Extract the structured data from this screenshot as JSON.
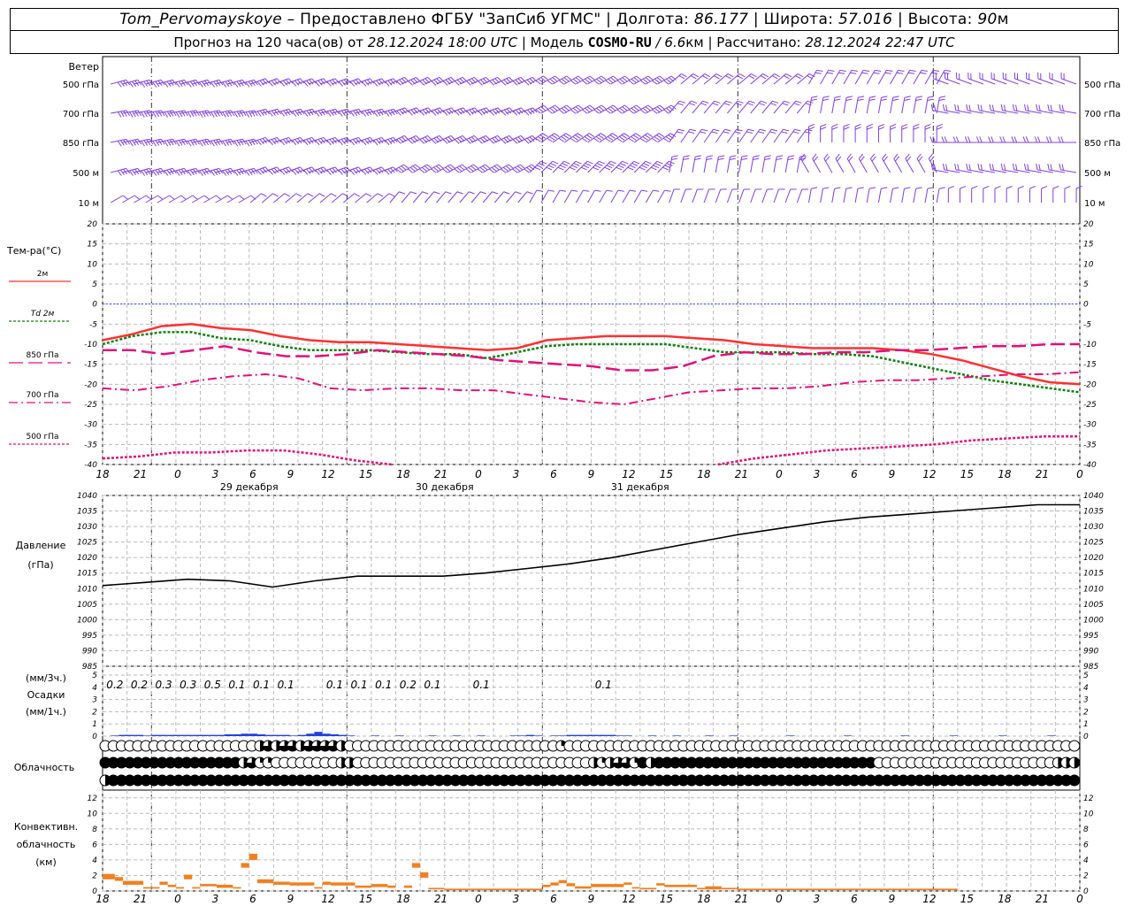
{
  "header": {
    "station": "Tom_Pervomayskoye",
    "provided_by": " – Предоставлено ФГБУ \"ЗапСиб УГМС\" | Долгота: ",
    "lon": "86.177",
    "lat_label": " | Широта: ",
    "lat": "57.016",
    "alt_label": " | Высота: ",
    "alt": "90",
    "alt_unit": "м",
    "forecast_prefix": "Прогноз на 120 часа(ов) от ",
    "forecast_time": "28.12.2024 18:00 UTC",
    "model_label": " | Модель ",
    "model": "COSMO-RU",
    "model_res": " / 6.6",
    "model_res_unit": "км",
    "calc_label": " | Рассчитано: ",
    "calc_time": "28.12.2024 22:47 UTC"
  },
  "time_axis": {
    "tick_labels": [
      "18",
      "21",
      "0",
      "3",
      "6",
      "9",
      "12",
      "15",
      "18",
      "21",
      "0",
      "3",
      "6",
      "9",
      "12",
      "15",
      "18",
      "21",
      "0",
      "3",
      "6",
      "9",
      "12",
      "15",
      "18",
      "21",
      "0"
    ],
    "day_labels": [
      "29 декабря",
      "30 декабря",
      "31 декабря"
    ]
  },
  "wind_panel": {
    "title": "Ветер",
    "levels": [
      "500 гПа",
      "700 гПа",
      "850 гПа",
      "500 м",
      "10 м"
    ],
    "barb_color": "#8040e0"
  },
  "colors": {
    "t2m": "#ff3030",
    "td2m": "#108010",
    "t850": "#e0107a",
    "t700": "#e0107a",
    "t500": "#e0107a",
    "zero_line": "#3050ff",
    "pressure": "#000000",
    "precip": "#2040e0",
    "convective": "#f08020",
    "grid": "#bbbbbb"
  },
  "chart_data": [
    {
      "type": "line",
      "title": "Тем-ра(°C)",
      "ylim": [
        -40,
        20
      ],
      "yticks": [
        20,
        15,
        10,
        5,
        0,
        -5,
        -10,
        -15,
        -20,
        -25,
        -30,
        -35,
        -40
      ],
      "x_hours": [
        0,
        3,
        6,
        9,
        12,
        15,
        18,
        21,
        24,
        27,
        30,
        33,
        36,
        39,
        42,
        45,
        48,
        51,
        54,
        57,
        60,
        63,
        66,
        69,
        72,
        75,
        78,
        81,
        84,
        87,
        90,
        93,
        96,
        99,
        102,
        105,
        108,
        111,
        114,
        117,
        120
      ],
      "series": [
        {
          "name": "2м",
          "values": [
            -9,
            -7.5,
            -5.5,
            -5,
            -6,
            -6.5,
            -8,
            -9,
            -9.5,
            -9.5,
            -10,
            -10.5,
            -11,
            -11.5,
            -11,
            -9,
            -8.5,
            -8,
            -8,
            -8,
            -8.5,
            -9,
            -10,
            -10.5,
            -11,
            -11,
            -11,
            -11.5,
            -12.5,
            -14,
            -16,
            -18,
            -19.5,
            -20
          ]
        },
        {
          "name": "Td 2м",
          "values": [
            -10,
            -8,
            -7,
            -7,
            -8.5,
            -9,
            -10.5,
            -11.5,
            -11.5,
            -11.5,
            -12,
            -12.5,
            -12.5,
            -13.5,
            -12,
            -10.5,
            -10,
            -10,
            -10,
            -10,
            -11,
            -12,
            -12,
            -12,
            -12.5,
            -12.5,
            -13,
            -14.5,
            -16,
            -17.5,
            -19,
            -20,
            -21,
            -22
          ]
        },
        {
          "name": "850 гПа",
          "values": [
            -11.5,
            -11.5,
            -12.5,
            -11.5,
            -10.5,
            -12,
            -13,
            -13,
            -12.5,
            -11.5,
            -12,
            -12.5,
            -13,
            -14,
            -14.5,
            -15,
            -15.5,
            -16.5,
            -16.5,
            -15.5,
            -13,
            -12,
            -12.5,
            -12.5,
            -12,
            -12,
            -11.5,
            -11.5,
            -11,
            -10.5,
            -10.5,
            -10,
            -10
          ]
        },
        {
          "name": "700 гПа",
          "values": [
            -21,
            -21.5,
            -20.5,
            -19,
            -18,
            -17.5,
            -18.5,
            -21,
            -21.5,
            -21,
            -21,
            -21.5,
            -21.5,
            -22.5,
            -23.5,
            -24.5,
            -25,
            -23.5,
            -22,
            -21.5,
            -21,
            -21,
            -20.5,
            -19.5,
            -19,
            -19,
            -18.5,
            -18,
            -17.5,
            -17.5,
            -17
          ]
        },
        {
          "name": "500 гПа",
          "values": [
            -38.5,
            -38,
            -37,
            -37,
            -36.5,
            -36.5,
            -37.5,
            -39,
            -40,
            -41,
            -40.5,
            -39.5,
            -40.5,
            -41.5,
            -41.5,
            -40.5,
            -41,
            -40,
            -38.5,
            -37.5,
            -36.5,
            -36,
            -35.5,
            -35,
            -34,
            -33.5,
            -33,
            -33
          ]
        }
      ]
    },
    {
      "type": "line",
      "title": "Давление (гПа)",
      "ylim": [
        985,
        1040
      ],
      "yticks": [
        1040,
        1035,
        1030,
        1025,
        1020,
        1015,
        1010,
        1005,
        1000,
        995,
        990,
        985
      ],
      "x_hours": [
        0,
        6,
        12,
        18,
        24,
        30,
        36,
        42,
        48,
        54,
        60,
        66,
        72,
        78,
        84,
        90,
        96,
        102,
        108,
        114,
        120
      ],
      "series": [
        {
          "name": "Давление",
          "values": [
            1011,
            1012,
            1013,
            1012.5,
            1010.5,
            1012.5,
            1014,
            1014,
            1014,
            1015,
            1016.5,
            1018,
            1020,
            1022.5,
            1025,
            1027.5,
            1029.5,
            1031.5,
            1033,
            1034,
            1035,
            1036,
            1037,
            1037
          ]
        }
      ]
    },
    {
      "type": "bar",
      "title": "Осадки",
      "subtitle_3h": "(мм/3ч.)",
      "subtitle_1h": "(мм/1ч.)",
      "ylim": [
        0,
        5
      ],
      "yticks": [
        5,
        4,
        3,
        2,
        1,
        0
      ],
      "labels_3h": [
        {
          "hour": 1.5,
          "text": "0.2"
        },
        {
          "hour": 4.5,
          "text": "0.2"
        },
        {
          "hour": 7.5,
          "text": "0.3"
        },
        {
          "hour": 10.5,
          "text": "0.3"
        },
        {
          "hour": 13.5,
          "text": "0.5"
        },
        {
          "hour": 16.5,
          "text": "0.1"
        },
        {
          "hour": 19.5,
          "text": "0.1"
        },
        {
          "hour": 22.5,
          "text": "0.1"
        },
        {
          "hour": 28.5,
          "text": "0.1"
        },
        {
          "hour": 31.5,
          "text": "0.1"
        },
        {
          "hour": 34.5,
          "text": "0.1"
        },
        {
          "hour": 37.5,
          "text": "0.2"
        },
        {
          "hour": 40.5,
          "text": "0.1"
        },
        {
          "hour": 46.5,
          "text": "0.1"
        },
        {
          "hour": 61.5,
          "text": "0.1"
        }
      ],
      "hourly_mm": [
        0,
        0.05,
        0.1,
        0.1,
        0.1,
        0.05,
        0.1,
        0.1,
        0.1,
        0.1,
        0.1,
        0.1,
        0.1,
        0.1,
        0.1,
        0.15,
        0.15,
        0.2,
        0.2,
        0.15,
        0.1,
        0.1,
        0.1,
        0.05,
        0.1,
        0.2,
        0.35,
        0.2,
        0.15,
        0.1,
        0.05,
        0,
        0,
        0.05,
        0,
        0,
        0.05,
        0,
        0,
        0,
        0.05,
        0,
        0,
        0.05,
        0,
        0,
        0.05,
        0,
        0,
        0,
        0.05,
        0.05,
        0.1,
        0.05,
        0,
        0.05,
        0.05,
        0.1,
        0.1,
        0.1,
        0.1,
        0.1,
        0.1,
        0.05,
        0.05,
        0,
        0,
        0.05,
        0,
        0,
        0.05,
        0,
        0,
        0,
        0.05,
        0,
        0,
        0.05,
        0,
        0,
        0,
        0,
        0,
        0,
        0.05,
        0,
        0,
        0,
        0,
        0,
        0,
        0.05,
        0,
        0,
        0,
        0,
        0,
        0,
        0.05,
        0,
        0,
        0,
        0,
        0,
        0.05,
        0,
        0,
        0,
        0,
        0,
        0.05,
        0,
        0,
        0,
        0,
        0,
        0.05,
        0,
        0,
        0,
        0
      ]
    },
    {
      "type": "table",
      "title": "Облачность",
      "rows_fraction": [
        [
          0,
          0,
          0,
          0,
          0,
          0,
          0,
          0,
          0,
          0,
          0,
          0,
          0,
          0,
          0,
          0,
          0,
          0,
          0,
          0.5,
          0.75,
          0.5,
          0.75,
          0.75,
          0.5,
          0.75,
          0.75,
          0.75,
          0.75,
          0.5,
          0,
          0,
          0,
          0,
          0,
          0,
          0,
          0,
          0,
          0,
          0,
          0,
          0,
          0,
          0,
          0,
          0,
          0,
          0,
          0,
          0,
          0,
          0,
          0,
          0,
          0,
          0.25,
          0,
          0,
          0,
          0,
          0,
          0,
          0,
          0,
          0,
          0,
          0,
          0,
          0,
          0,
          0,
          0,
          0,
          0,
          0,
          0,
          0,
          0,
          0,
          0,
          0,
          0,
          0,
          0,
          0,
          0,
          0,
          0,
          0,
          0,
          0,
          0,
          0,
          0,
          0,
          0,
          0,
          0,
          0,
          0,
          0,
          0,
          0,
          0,
          0,
          0,
          0,
          0,
          0,
          0,
          0,
          0,
          0,
          0,
          0,
          0,
          0,
          0,
          0,
          0.5,
          0.5,
          0.25
        ],
        [
          1,
          1,
          1,
          1,
          1,
          1,
          1,
          1,
          1,
          1,
          1,
          1,
          1,
          1,
          1,
          1,
          1,
          0.5,
          0.75,
          0.25,
          0.25,
          0,
          0,
          0,
          0,
          0,
          0,
          0,
          0,
          0.5,
          0.5,
          0,
          0,
          0,
          0,
          0,
          0,
          0,
          0,
          0,
          0,
          0,
          0,
          0,
          0,
          0,
          0,
          0,
          0,
          0,
          0,
          0,
          0,
          0,
          0,
          0,
          0,
          0,
          0,
          0,
          0.5,
          0.25,
          0.5,
          0.75,
          0.75,
          0.25,
          1,
          0.5,
          1,
          1,
          1,
          1,
          1,
          1,
          1,
          1,
          1,
          1,
          1,
          1,
          1,
          1,
          1,
          1,
          1,
          1,
          1,
          1,
          1,
          1,
          1,
          1,
          1,
          1,
          1,
          0,
          0,
          0,
          0,
          0,
          0,
          0,
          0,
          0,
          0,
          0,
          0,
          0,
          0,
          0,
          0,
          0,
          0,
          0,
          0,
          0,
          0,
          0.5,
          0.5,
          0.5,
          0,
          0,
          0,
          0,
          0,
          0,
          0,
          0,
          0,
          0,
          0,
          0,
          0,
          0,
          0,
          0,
          0,
          0.5,
          0.5,
          0.5,
          0.75,
          0.25,
          0.75,
          0.75
        ],
        [
          0.5,
          1,
          1,
          1,
          1,
          1,
          1,
          1,
          1,
          1,
          1,
          1,
          1,
          1,
          1,
          1,
          1,
          1,
          1,
          1,
          1,
          1,
          1,
          1,
          1,
          1,
          1,
          1,
          1,
          1,
          1,
          1,
          1,
          1,
          1,
          1,
          1,
          1,
          1,
          1,
          1,
          1,
          1,
          1,
          1,
          1,
          1,
          1,
          1,
          1,
          1,
          1,
          1,
          1,
          1,
          1,
          1,
          1,
          1,
          1,
          1,
          1,
          1,
          1,
          1,
          1,
          1,
          1,
          1,
          1,
          1,
          1,
          1,
          1,
          1,
          1,
          1,
          1,
          1,
          1,
          1,
          1,
          1,
          1,
          1,
          1,
          1,
          1,
          1,
          1,
          1,
          1,
          1,
          1,
          1,
          1,
          1,
          1,
          1,
          1,
          1,
          1,
          1,
          1,
          1,
          1,
          1,
          1,
          1,
          1,
          1,
          1,
          1,
          1,
          1,
          1,
          1,
          1,
          1,
          1,
          1
        ]
      ]
    },
    {
      "type": "bar",
      "title": "Конвективн. облачность (км)",
      "ylim": [
        0,
        13
      ],
      "yticks": [
        12,
        10,
        8,
        6,
        4,
        2,
        0
      ],
      "segments": [
        {
          "h0": 0,
          "h1": 1.5,
          "base": 1.5,
          "top": 2.2
        },
        {
          "h0": 1.5,
          "h1": 2.5,
          "base": 1.3,
          "top": 1.8
        },
        {
          "h0": 2.5,
          "h1": 5,
          "base": 0.8,
          "top": 1.3
        },
        {
          "h0": 5,
          "h1": 7,
          "base": 0.3,
          "top": 0.5
        },
        {
          "h0": 7,
          "h1": 8,
          "base": 0.8,
          "top": 1.2
        },
        {
          "h0": 8,
          "h1": 9,
          "base": 0.5,
          "top": 0.8
        },
        {
          "h0": 9,
          "h1": 10,
          "base": 0.3,
          "top": 0.5
        },
        {
          "h0": 10,
          "h1": 11,
          "base": 1.5,
          "top": 2.1
        },
        {
          "h0": 11,
          "h1": 12,
          "base": 0.3,
          "top": 0.5
        },
        {
          "h0": 12,
          "h1": 14,
          "base": 0.6,
          "top": 0.9
        },
        {
          "h0": 14,
          "h1": 16,
          "base": 0.4,
          "top": 0.8
        },
        {
          "h0": 16,
          "h1": 17,
          "base": 0.3,
          "top": 0.5
        },
        {
          "h0": 17,
          "h1": 18,
          "base": 3,
          "top": 3.6
        },
        {
          "h0": 18,
          "h1": 19,
          "base": 4,
          "top": 4.8
        },
        {
          "h0": 19,
          "h1": 21,
          "base": 1,
          "top": 1.5
        },
        {
          "h0": 21,
          "h1": 23,
          "base": 0.8,
          "top": 1.2
        },
        {
          "h0": 23,
          "h1": 26,
          "base": 0.7,
          "top": 1.1
        },
        {
          "h0": 26,
          "h1": 27,
          "base": 0.3,
          "top": 0.5
        },
        {
          "h0": 27,
          "h1": 28,
          "base": 0.8,
          "top": 1.2
        },
        {
          "h0": 28,
          "h1": 31,
          "base": 0.7,
          "top": 1.1
        },
        {
          "h0": 31,
          "h1": 33,
          "base": 0.4,
          "top": 0.7
        },
        {
          "h0": 33,
          "h1": 35,
          "base": 0.5,
          "top": 0.9
        },
        {
          "h0": 35,
          "h1": 36,
          "base": 0.4,
          "top": 0.7
        },
        {
          "h0": 37,
          "h1": 38,
          "base": 0.4,
          "top": 0.7
        },
        {
          "h0": 38,
          "h1": 39,
          "base": 3,
          "top": 3.6
        },
        {
          "h0": 39,
          "h1": 40,
          "base": 1.7,
          "top": 2.4
        },
        {
          "h0": 40,
          "h1": 42,
          "base": 0.2,
          "top": 0.4
        },
        {
          "h0": 42,
          "h1": 54,
          "base": 0.1,
          "top": 0.3
        },
        {
          "h0": 54,
          "h1": 55,
          "base": 0.5,
          "top": 0.8
        },
        {
          "h0": 55,
          "h1": 56,
          "base": 0.7,
          "top": 1.1
        },
        {
          "h0": 56,
          "h1": 57,
          "base": 1,
          "top": 1.4
        },
        {
          "h0": 57,
          "h1": 58,
          "base": 0.6,
          "top": 1
        },
        {
          "h0": 58,
          "h1": 60,
          "base": 0.3,
          "top": 0.6
        },
        {
          "h0": 60,
          "h1": 64,
          "base": 0.5,
          "top": 0.9
        },
        {
          "h0": 64,
          "h1": 65,
          "base": 0.8,
          "top": 1.1
        },
        {
          "h0": 65,
          "h1": 66,
          "base": 0.3,
          "top": 0.5
        },
        {
          "h0": 66,
          "h1": 68,
          "base": 0.2,
          "top": 0.4
        },
        {
          "h0": 68,
          "h1": 69,
          "base": 0.7,
          "top": 1
        },
        {
          "h0": 69,
          "h1": 73,
          "base": 0.5,
          "top": 0.8
        },
        {
          "h0": 73,
          "h1": 74,
          "base": 0.2,
          "top": 0.4
        },
        {
          "h0": 74,
          "h1": 76,
          "base": 0.2,
          "top": 0.6
        },
        {
          "h0": 76,
          "h1": 78,
          "base": 0.2,
          "top": 0.4
        },
        {
          "h0": 78,
          "h1": 82,
          "base": 0.1,
          "top": 0.3
        },
        {
          "h0": 82,
          "h1": 90,
          "base": 0.1,
          "top": 0.3
        },
        {
          "h0": 90,
          "h1": 105,
          "base": 0.1,
          "top": 0.3
        }
      ]
    }
  ]
}
